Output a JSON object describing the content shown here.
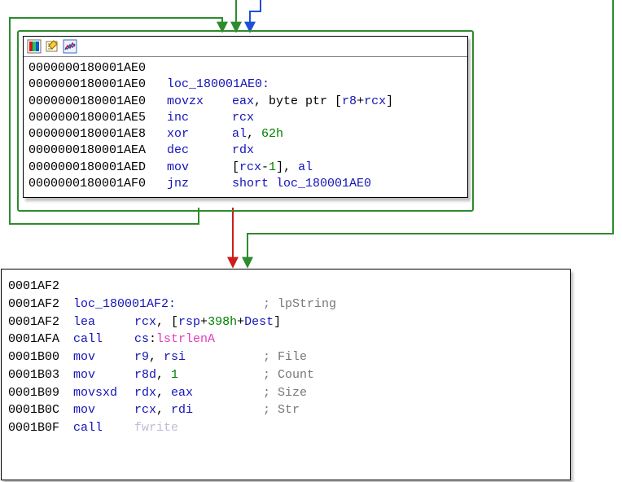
{
  "block1": {
    "addr_header": "0000000180001AE0",
    "label_line": {
      "addr": "0000000180001AE0",
      "label": "loc_180001AE0:"
    },
    "rows": [
      {
        "addr": "0000000180001AE0",
        "mnem": "movzx",
        "ops_html": "<span class='reg'>eax</span><span class='txt'>, byte ptr [</span><span class='reg'>r8</span><span class='txt'>+</span><span class='reg'>rcx</span><span class='txt'>]</span>"
      },
      {
        "addr": "0000000180001AE5",
        "mnem": "inc",
        "ops_html": "<span class='reg'>rcx</span>"
      },
      {
        "addr": "0000000180001AE8",
        "mnem": "xor",
        "ops_html": "<span class='reg'>al</span><span class='txt'>, </span><span class='num'>62h</span>"
      },
      {
        "addr": "0000000180001AEA",
        "mnem": "dec",
        "ops_html": "<span class='reg'>rdx</span>"
      },
      {
        "addr": "0000000180001AED",
        "mnem": "mov",
        "ops_html": "<span class='txt'>[</span><span class='reg'>rcx</span><span class='txt'>-</span><span class='num'>1</span><span class='txt'>], </span><span class='reg'>al</span>"
      },
      {
        "addr": "0000000180001AF0",
        "mnem": "jnz",
        "ops_html": "<span class='name'>short loc_180001AE0</span>"
      }
    ]
  },
  "block2": {
    "addr_header": "0001AF2",
    "label_line": {
      "addr": "0001AF2",
      "label": "loc_180001AF2:",
      "comment": "; lpString"
    },
    "rows": [
      {
        "addr": "0001AF2",
        "mnem": "lea",
        "ops_html": "<span class='reg'>rcx</span><span class='txt'>, [</span><span class='reg'>rsp</span><span class='txt'>+</span><span class='num'>398h</span><span class='txt'>+</span><span class='name'>Dest</span><span class='txt'>]</span>",
        "comment": ""
      },
      {
        "addr": "0001AFA",
        "mnem": "call",
        "ops_html": "<span class='reg'>cs</span><span class='txt'>:</span><span class='api'>lstrlenA</span>",
        "comment": ""
      },
      {
        "addr": "0001B00",
        "mnem": "mov",
        "ops_html": "<span class='reg'>r9</span><span class='txt'>, </span><span class='reg'>rsi</span>",
        "comment": "; File"
      },
      {
        "addr": "0001B03",
        "mnem": "mov",
        "ops_html": "<span class='reg'>r8d</span><span class='txt'>, </span><span class='num'>1</span>",
        "comment": "; Count"
      },
      {
        "addr": "0001B09",
        "mnem": "movsxd",
        "ops_html": "<span class='reg'>rdx</span><span class='txt'>, </span><span class='reg'>eax</span>",
        "comment": "; Size"
      },
      {
        "addr": "0001B0C",
        "mnem": "mov",
        "ops_html": "<span class='reg'>rcx</span><span class='txt'>, </span><span class='reg'>rdi</span>",
        "comment": "; Str"
      },
      {
        "addr": "0001B0F",
        "mnem": "call",
        "ops_html": "<span class='faint'>fwrite</span>",
        "comment": ""
      }
    ]
  }
}
